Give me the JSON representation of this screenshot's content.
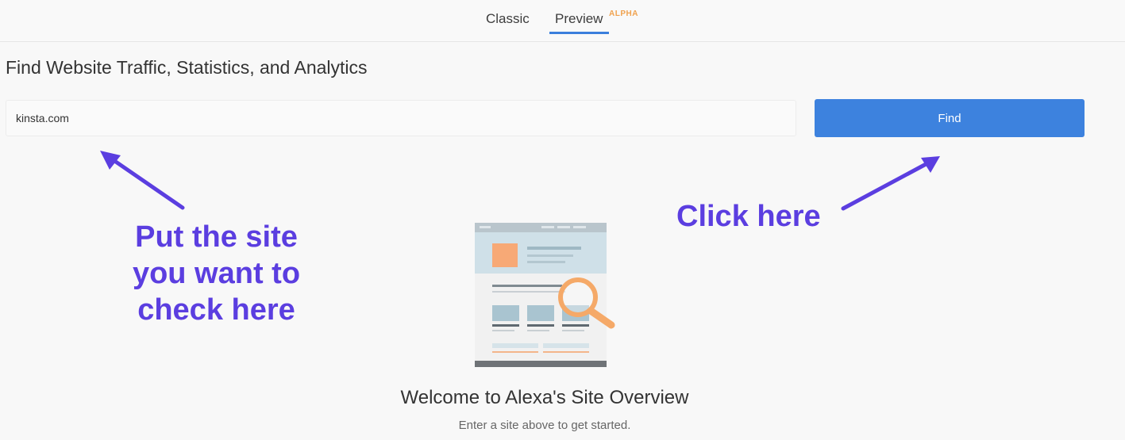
{
  "tabs": {
    "classic": "Classic",
    "preview": "Preview",
    "preview_badge": "ALPHA"
  },
  "page_title": "Find Website Traffic, Statistics, and Analytics",
  "search": {
    "value": "kinsta.com",
    "button_label": "Find"
  },
  "annotations": {
    "left_lines": [
      "Put the site",
      "you want to",
      "check here"
    ],
    "right": "Click here"
  },
  "welcome": {
    "title": "Welcome to Alexa's Site Overview",
    "subtitle": "Enter a site above to get started."
  },
  "colors": {
    "accent": "#3d82de",
    "annotation": "#5b3ee0",
    "badge": "#f0a24f"
  }
}
